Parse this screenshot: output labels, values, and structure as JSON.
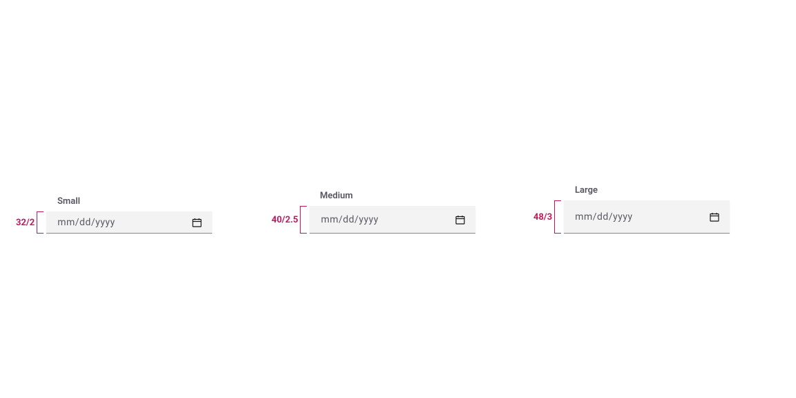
{
  "variants": {
    "small": {
      "label": "Small",
      "dimension": "32/2",
      "placeholder": "mm/dd/yyyy"
    },
    "medium": {
      "label": "Medium",
      "dimension": "40/2.5",
      "placeholder": "mm/dd/yyyy"
    },
    "large": {
      "label": "Large",
      "dimension": "48/3",
      "placeholder": "mm/dd/yyyy"
    }
  },
  "colors": {
    "accent": "#c2185b",
    "field_bg": "#f3f3f4",
    "placeholder": "#5a5a63"
  }
}
